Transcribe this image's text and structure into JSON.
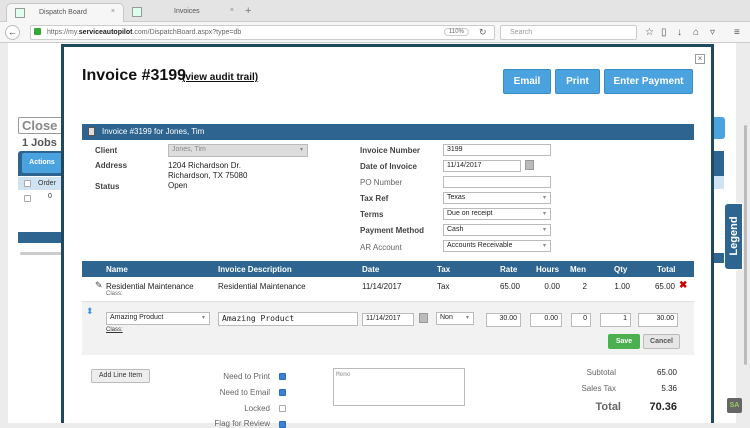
{
  "browser": {
    "tabs": [
      {
        "title": "Dispatch Board",
        "active": true
      },
      {
        "title": "Invoices",
        "active": false
      }
    ],
    "url_prefix": "https://my.",
    "url_domain": "serviceautopilot",
    "url_suffix": ".com/DispatchBoard.aspx?type=db",
    "zoom": "110%",
    "search_placeholder": "Search"
  },
  "background": {
    "close_label": "Close",
    "jobs_label": "1 Jobs",
    "actions_label": "Actions",
    "order_header": "Order",
    "row_value": "0",
    "legend_label": "Legend",
    "sa_badge": "SA"
  },
  "invoice": {
    "title": "Invoice #3199",
    "audit_link": "(view audit trail)",
    "buttons": {
      "email": "Email",
      "print": "Print",
      "enter_payment": "Enter Payment"
    },
    "section_title": "Invoice #3199 for Jones, Tim",
    "client_label": "Client",
    "client_value": "Jones, Tim",
    "address_label": "Address",
    "address_line1": "1204 Richardson Dr.",
    "address_line2": "Richardson, TX 75080",
    "status_label": "Status",
    "status_value": "Open",
    "fields": {
      "invoice_number_label": "Invoice Number",
      "invoice_number": "3199",
      "date_label": "Date of Invoice",
      "date": "11/14/2017",
      "po_label": "PO Number",
      "po": "",
      "tax_ref_label": "Tax Ref",
      "tax_ref": "Texas",
      "terms_label": "Terms",
      "terms": "Due on receipt",
      "payment_method_label": "Payment Method",
      "payment_method": "Cash",
      "ar_account_label": "AR Account",
      "ar_account": "Accounts Receivable"
    },
    "columns": {
      "name": "Name",
      "description": "Invoice Description",
      "date": "Date",
      "tax": "Tax",
      "rate": "Rate",
      "hours": "Hours",
      "men": "Men",
      "qty": "Qty",
      "total": "Total"
    },
    "line_items": [
      {
        "name": "Residential Maintenance",
        "class_label": "Class:",
        "description": "Residential Maintenance",
        "date": "11/14/2017",
        "tax": "Tax",
        "rate": "65.00",
        "hours": "0.00",
        "men": "2",
        "qty": "1.00",
        "total": "65.00"
      }
    ],
    "edit_row": {
      "name": "Amazing Product",
      "class_label": "Class:",
      "description": "Amazing Product",
      "date": "11/14/2017",
      "tax": "Non",
      "rate": "30.00",
      "hours": "0.00",
      "men": "0",
      "qty": "1",
      "total": "30.00",
      "save": "Save",
      "cancel": "Cancel"
    },
    "add_line_item": "Add Line Item",
    "flags": [
      {
        "label": "Need to Print",
        "checked": true
      },
      {
        "label": "Need to Email",
        "checked": true
      },
      {
        "label": "Locked",
        "checked": false
      },
      {
        "label": "Flag for Review",
        "checked": true
      }
    ],
    "memo_placeholder": "Memo",
    "totals": {
      "subtotal_label": "Subtotal",
      "subtotal": "65.00",
      "sales_tax_label": "Sales Tax",
      "sales_tax": "5.36",
      "total_label": "Total",
      "total": "70.36"
    }
  }
}
